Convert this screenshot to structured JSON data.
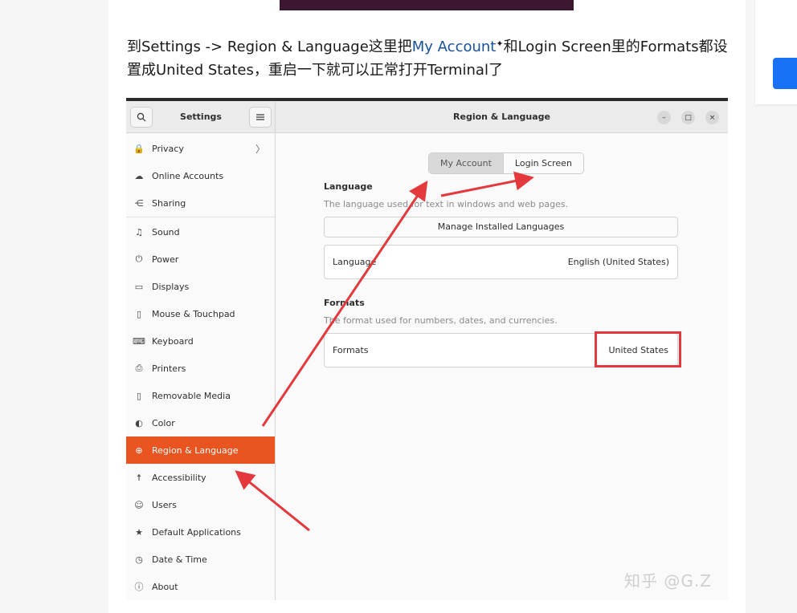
{
  "article": {
    "paragraph_pre": "到Settings -> Region & Language这里把",
    "link_text": "My Account",
    "link_mark": "✦",
    "paragraph_post": "和Login Screen里的Formats都设置成United States，重启一下就可以正常打开Terminal了"
  },
  "settings": {
    "sidebar_title": "Settings",
    "search_icon": "search-icon",
    "menu_icon": "hamburger-icon",
    "window_title": "Region & Language",
    "window_controls": {
      "minimize": "–",
      "maximize": "□",
      "close": "×"
    },
    "sidebar_items": [
      {
        "label": "Privacy",
        "icon": "🔒",
        "chevron": "〉"
      },
      {
        "label": "Online Accounts",
        "icon": "☁"
      },
      {
        "label": "Sharing",
        "icon": "⋲"
      },
      {
        "label": "Sound",
        "icon": "♫"
      },
      {
        "label": "Power",
        "icon": "⏻"
      },
      {
        "label": "Displays",
        "icon": "▭"
      },
      {
        "label": "Mouse & Touchpad",
        "icon": "▯"
      },
      {
        "label": "Keyboard",
        "icon": "⌨"
      },
      {
        "label": "Printers",
        "icon": "⎙"
      },
      {
        "label": "Removable Media",
        "icon": "▯"
      },
      {
        "label": "Color",
        "icon": "◐"
      },
      {
        "label": "Region & Language",
        "icon": "⊕"
      },
      {
        "label": "Accessibility",
        "icon": "☨"
      },
      {
        "label": "Users",
        "icon": "☺"
      },
      {
        "label": "Default Applications",
        "icon": "★"
      },
      {
        "label": "Date & Time",
        "icon": "◷"
      },
      {
        "label": "About",
        "icon": "ⓘ"
      }
    ],
    "active_item": "Region & Language",
    "tabs": {
      "my_account": "My Account",
      "login_screen": "Login Screen"
    },
    "language": {
      "heading": "Language",
      "subtitle": "The language used for text in windows and web pages.",
      "manage_button": "Manage Installed Languages",
      "row_label": "Language",
      "row_value": "English (United States)"
    },
    "formats": {
      "heading": "Formats",
      "subtitle": "The format used for numbers, dates, and currencies.",
      "row_label": "Formats",
      "row_value": "United States"
    },
    "watermark": "知乎 @G.Z"
  },
  "colors": {
    "accent": "#e95420",
    "annotation": "#e4393c",
    "link": "#175199",
    "cta": "#1772f6"
  }
}
